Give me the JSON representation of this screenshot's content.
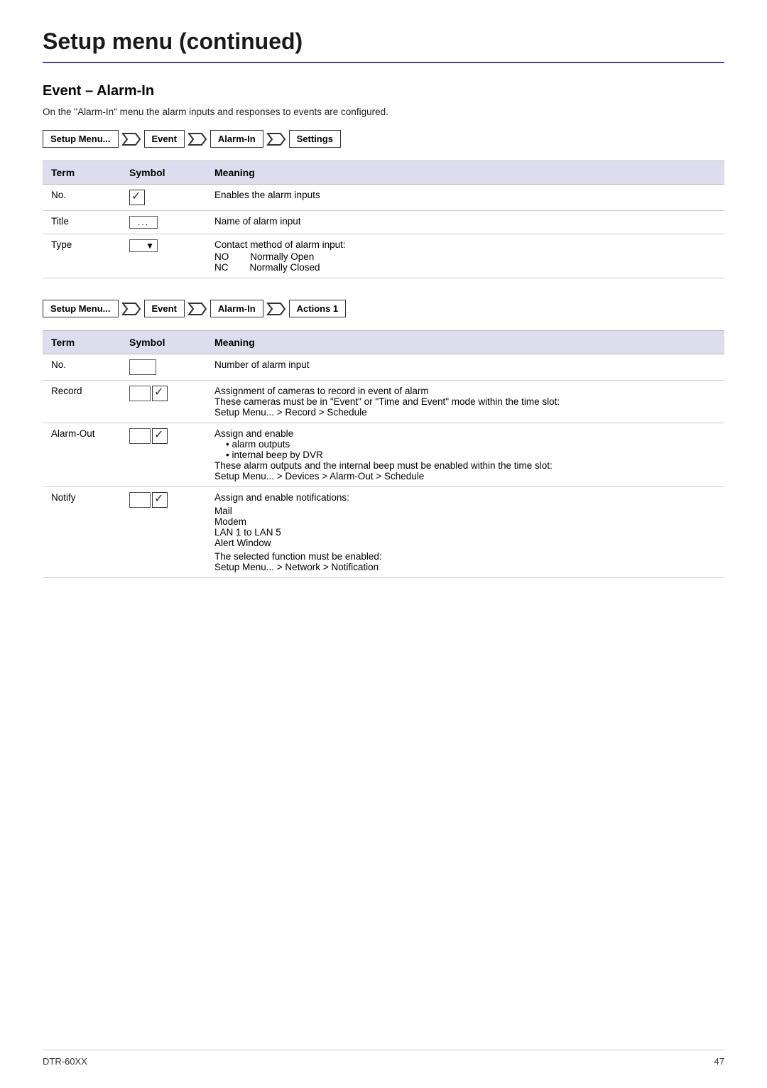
{
  "page": {
    "title": "Setup menu (continued)",
    "footer_model": "DTR-60XX",
    "footer_page": "47"
  },
  "section1": {
    "title": "Event – Alarm-In",
    "intro": "On the \"Alarm-In\" menu the alarm inputs and responses to events are configured.",
    "breadcrumb": [
      {
        "label": "Setup Menu...",
        "type": "box"
      },
      {
        "label": "→",
        "type": "arrow"
      },
      {
        "label": "Event",
        "type": "box"
      },
      {
        "label": "→",
        "type": "arrow"
      },
      {
        "label": "Alarm-In",
        "type": "box"
      },
      {
        "label": "→",
        "type": "arrow"
      },
      {
        "label": "Settings",
        "type": "box"
      }
    ],
    "table": {
      "headers": [
        "Term",
        "Symbol",
        "Meaning"
      ],
      "rows": [
        {
          "term": "No.",
          "symbol": "checkbox_checked",
          "meaning": "Enables the alarm inputs"
        },
        {
          "term": "Title",
          "symbol": "dots",
          "meaning": "Name of alarm input"
        },
        {
          "term": "Type",
          "symbol": "dropdown",
          "meaning_lines": [
            "Contact method of alarm input:",
            "NO    Normally Open",
            "NC    Normally Closed"
          ]
        }
      ]
    }
  },
  "section2": {
    "breadcrumb": [
      {
        "label": "Setup Menu...",
        "type": "box"
      },
      {
        "label": "→",
        "type": "arrow"
      },
      {
        "label": "Event",
        "type": "box"
      },
      {
        "label": "→",
        "type": "arrow"
      },
      {
        "label": "Alarm-In",
        "type": "box"
      },
      {
        "label": "→",
        "type": "arrow"
      },
      {
        "label": "Actions 1",
        "type": "box"
      }
    ],
    "table": {
      "headers": [
        "Term",
        "Symbol",
        "Meaning"
      ],
      "rows": [
        {
          "term": "No.",
          "symbol": "blank_box",
          "meaning": "Number of alarm input"
        },
        {
          "term": "Record",
          "symbol": "box_check",
          "meaning_lines": [
            "Assignment of cameras to record in event of alarm",
            "These cameras must be in \"Event\" or \"Time and Event\" mode within the time slot:",
            "Setup Menu... > Record > Schedule"
          ]
        },
        {
          "term": "Alarm-Out",
          "symbol": "box_check",
          "meaning_lines": [
            "Assign and enable",
            "• alarm outputs",
            "• internal beep by DVR",
            "These alarm outputs and the internal beep must be enabled within the time slot:",
            "Setup Menu... > Devices > Alarm-Out > Schedule"
          ]
        },
        {
          "term": "Notify",
          "symbol": "box_check",
          "meaning_lines": [
            "Assign and enable notifications:",
            "",
            "Mail",
            "Modem",
            "LAN 1 to LAN 5",
            "Alert Window",
            "",
            "The selected function must be enabled:",
            "Setup Menu... > Network > Notification"
          ]
        }
      ]
    }
  }
}
